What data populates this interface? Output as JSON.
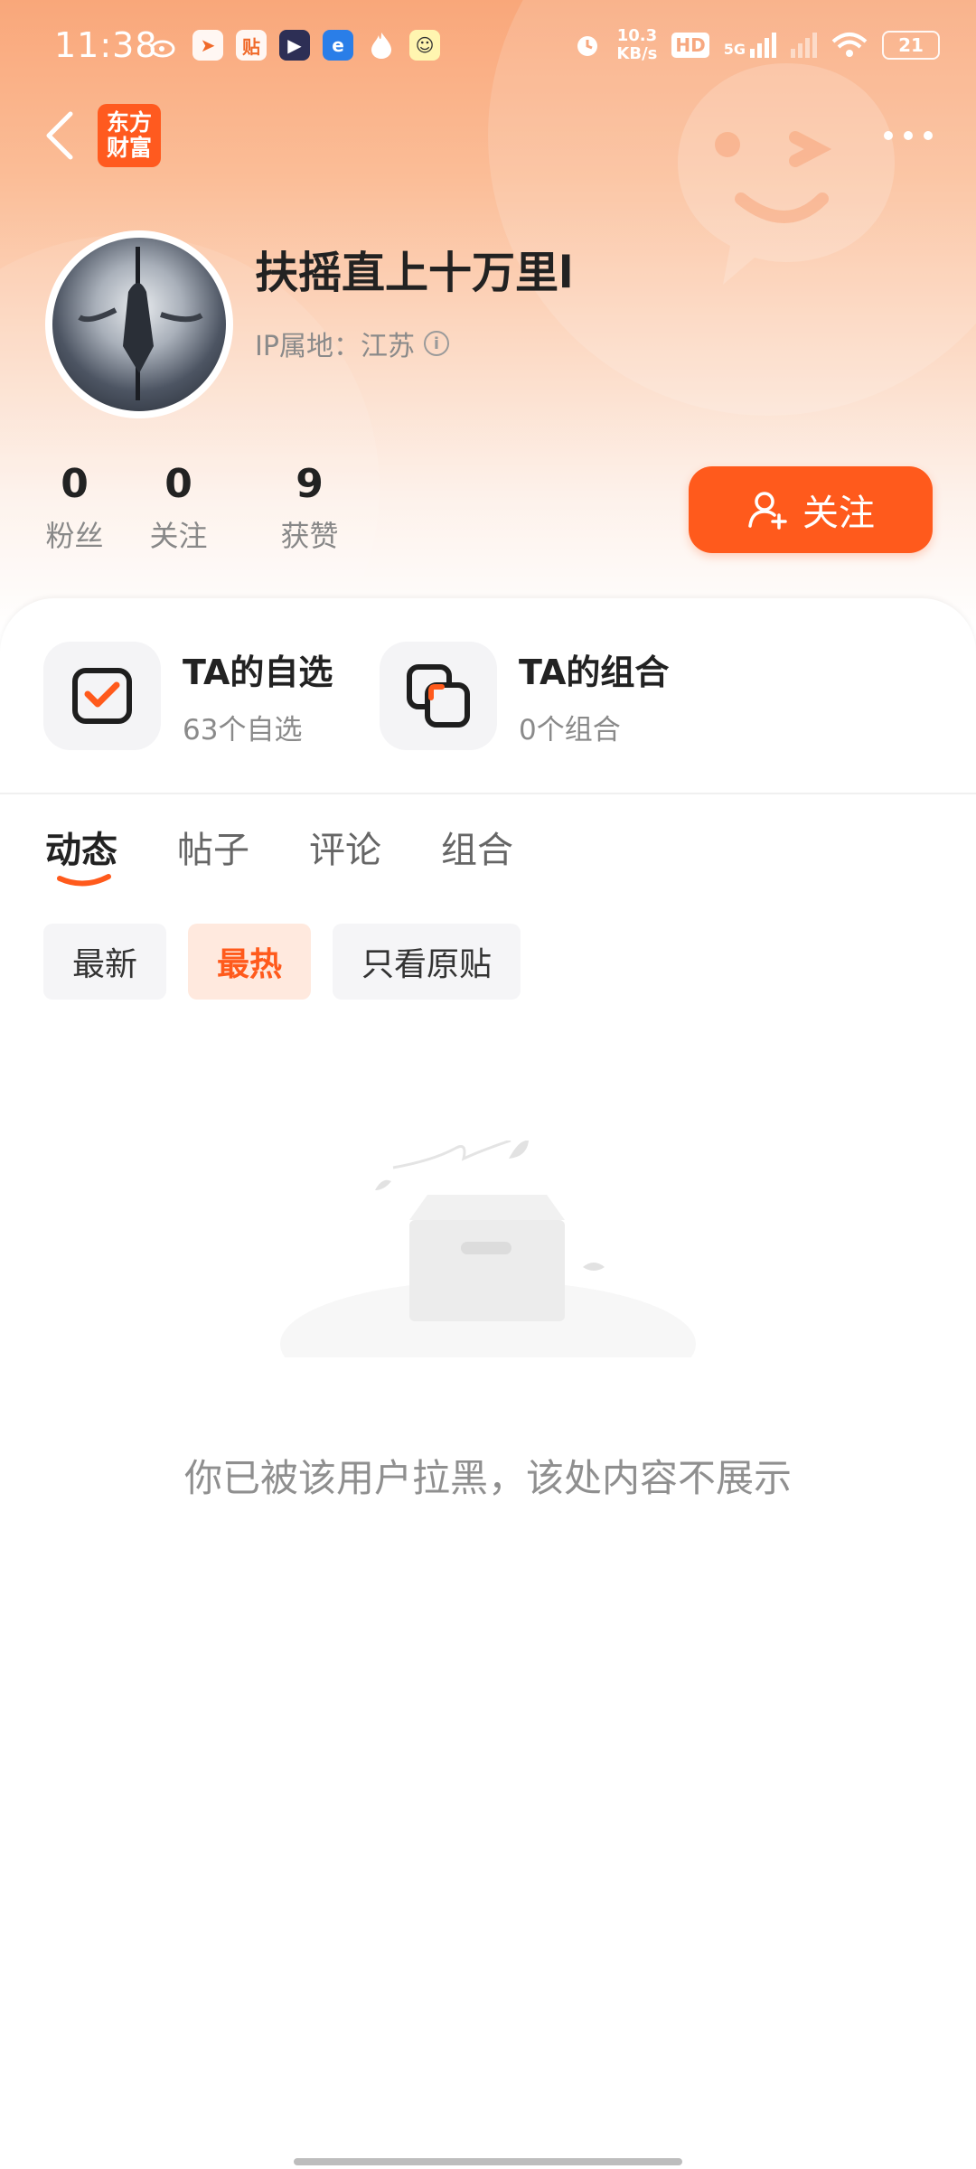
{
  "status_bar": {
    "time": "11:38",
    "apps": [
      "贴"
    ],
    "net_speed_value": "10.3",
    "net_speed_unit": "KB/s",
    "hd_label": "HD",
    "network": "5G",
    "battery": "21"
  },
  "header": {
    "logo_line1": "东方",
    "logo_line2": "财富"
  },
  "profile": {
    "username": "扶摇直上十万里l",
    "ip_label": "IP属地：江苏",
    "stats": [
      {
        "value": "0",
        "label": "粉丝"
      },
      {
        "value": "0",
        "label": "关注"
      },
      {
        "value": "9",
        "label": "获赞"
      }
    ],
    "follow_label": "关注"
  },
  "features": [
    {
      "title": "TA的自选",
      "subtitle": "63个自选"
    },
    {
      "title": "TA的组合",
      "subtitle": "0个组合"
    }
  ],
  "tabs": [
    {
      "label": "动态",
      "active": true
    },
    {
      "label": "帖子",
      "active": false
    },
    {
      "label": "评论",
      "active": false
    },
    {
      "label": "组合",
      "active": false
    }
  ],
  "filters": [
    {
      "label": "最新",
      "active": false
    },
    {
      "label": "最热",
      "active": true
    },
    {
      "label": "只看原贴",
      "active": false
    }
  ],
  "empty_message": "你已被该用户拉黑，该处内容不展示",
  "colors": {
    "accent": "#ff5a1c",
    "hero_top": "#f9a77a"
  }
}
